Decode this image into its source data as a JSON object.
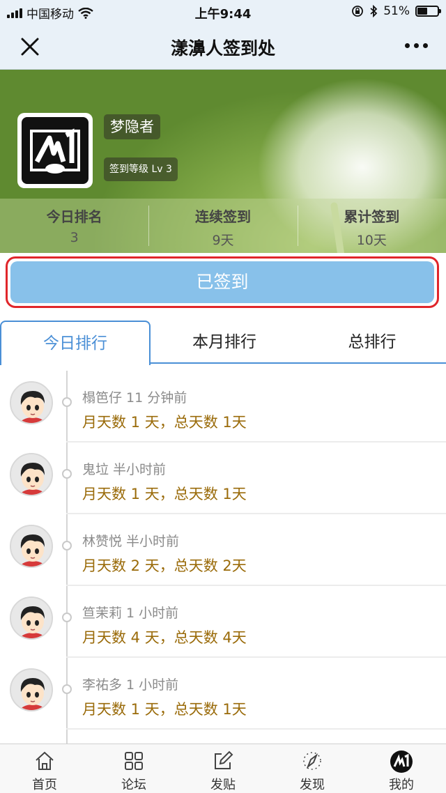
{
  "status_bar": {
    "carrier": "中国移动",
    "time": "上午9:44",
    "battery_text": "51%",
    "battery_level": 0.51
  },
  "nav": {
    "title": "漾濞人签到处",
    "close_icon": "close-icon",
    "more_icon": "more-icon"
  },
  "profile": {
    "nickname": "梦隐者",
    "level": "签到等级 Lv 3"
  },
  "stats": [
    {
      "title": "今日排名",
      "value": "3"
    },
    {
      "title": "连续签到",
      "value": "9天"
    },
    {
      "title": "累计签到",
      "value": "10天"
    }
  ],
  "checkin": {
    "label": "已签到",
    "highlight_color": "#e0262b",
    "button_color": "#88c1ea"
  },
  "tabs": [
    {
      "label": "今日排行",
      "active": true
    },
    {
      "label": "本月排行",
      "active": false
    },
    {
      "label": "总排行",
      "active": false
    }
  ],
  "list": [
    {
      "name_time": "榻笆仔 11 分钟前",
      "days": "月天数 1 天，总天数 1天"
    },
    {
      "name_time": "鬼垃 半小时前",
      "days": "月天数 1 天，总天数 1天"
    },
    {
      "name_time": "林赞悦 半小时前",
      "days": "月天数 2 天，总天数 2天"
    },
    {
      "name_time": "笪茉莉 1 小时前",
      "days": "月天数 4 天，总天数 4天"
    },
    {
      "name_time": "李祐多 1 小时前",
      "days": "月天数 1 天，总天数 1天"
    }
  ],
  "tabbar": [
    {
      "label": "首页",
      "icon": "home-icon"
    },
    {
      "label": "论坛",
      "icon": "grid-icon"
    },
    {
      "label": "发贴",
      "icon": "edit-icon"
    },
    {
      "label": "发现",
      "icon": "compass-icon"
    },
    {
      "label": "我的",
      "icon": "profile-avatar-icon"
    }
  ],
  "colors": {
    "accent": "#4a8fd6",
    "days_text": "#9a6b0a"
  }
}
